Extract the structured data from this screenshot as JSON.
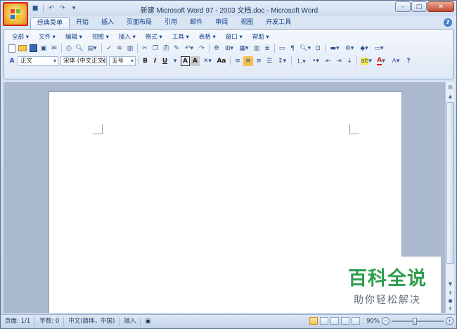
{
  "window": {
    "title": "新建 Microsoft Word 97 - 2003 文档.doc - Microsoft Word",
    "controls": {
      "minimize": "–",
      "maximize": "□",
      "close": "✕"
    }
  },
  "quick_access": {
    "save_icon": "save-icon",
    "undo_icon": "undo-icon",
    "redo_icon": "redo-icon",
    "customize_icon": "dropdown-arrow-icon"
  },
  "tabs": [
    {
      "label": "经典菜单",
      "active": true
    },
    {
      "label": "开始"
    },
    {
      "label": "插入"
    },
    {
      "label": "页面布局"
    },
    {
      "label": "引用"
    },
    {
      "label": "邮件"
    },
    {
      "label": "审阅"
    },
    {
      "label": "视图"
    },
    {
      "label": "开发工具"
    }
  ],
  "menubar": [
    {
      "label": "全部 ▾"
    },
    {
      "label": "文件 ▾"
    },
    {
      "label": "编辑 ▾"
    },
    {
      "label": "视图 ▾"
    },
    {
      "label": "插入 ▾"
    },
    {
      "label": "格式 ▾"
    },
    {
      "label": "工具 ▾"
    },
    {
      "label": "表格 ▾"
    },
    {
      "label": "窗口 ▾"
    },
    {
      "label": "帮助 ▾"
    }
  ],
  "format_bar": {
    "style": "正文",
    "font": "宋体 (中文正文)",
    "size": "五号",
    "bold": "B",
    "italic": "I",
    "underline": "U",
    "char_border": "A",
    "char_shading": "A",
    "case": "Aa",
    "font_color_glyph": "A",
    "highlight_glyph": "ab"
  },
  "statusbar": {
    "page": "页面: 1/1",
    "words": "字数: 0",
    "language": "中文(简体，中国)",
    "mode": "插入",
    "zoom": "90%",
    "zoom_percent": 90
  },
  "watermark": {
    "title": "百科全说",
    "subtitle": "助你轻松解决"
  },
  "colors": {
    "accent": "#15428b",
    "watermark_green": "#2d9d4e",
    "office_button_highlight": "#d81e1e"
  }
}
